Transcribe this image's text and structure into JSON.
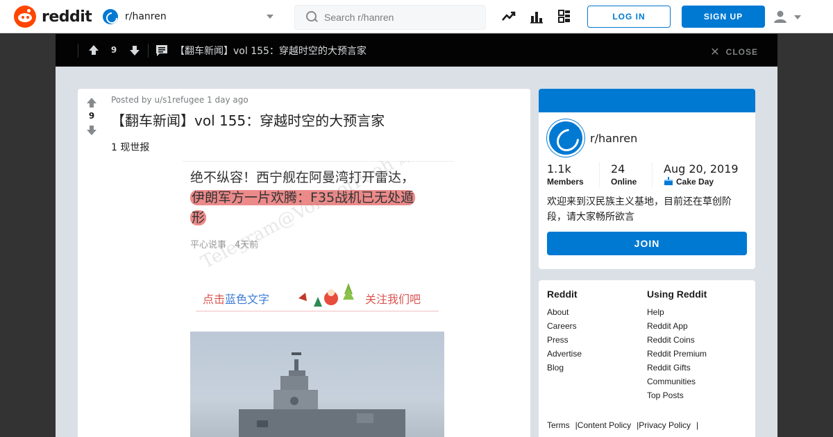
{
  "header": {
    "logo_text": "reddit",
    "community": "r/hanren",
    "search_placeholder": "Search r/hanren",
    "login_label": "LOG IN",
    "signup_label": "SIGN UP"
  },
  "overlay": {
    "score": "9",
    "title": "【翻车新闻】vol 155：穿越时空的大预言家",
    "close_label": "CLOSE"
  },
  "post": {
    "score": "9",
    "meta": "Posted by u/s1refugee 1 day ago",
    "title": "【翻车新闻】vol 155：穿越时空的大预言家",
    "flair": "1 现世报",
    "image": {
      "headline_part1": "绝不纵容！西宁舰在阿曼湾打开雷达，",
      "headline_part2": "伊朗军方一片欢腾：F35战机已无处遁",
      "headline_part3": "形",
      "source": "平心说事",
      "source_time": "4天前",
      "follow_part1": "点击",
      "follow_blue": "蓝色文字",
      "follow_part2": "关注我们吧",
      "watermark": "Telegram@VoiceofPooh 維尼之聲"
    }
  },
  "about": {
    "name": "r/hanren",
    "members_value": "1.1k",
    "members_label": "Members",
    "online_value": "24",
    "online_label": "Online",
    "created_value": "Aug 20, 2019",
    "created_label": "Cake Day",
    "description": "欢迎来到汉民族主义基地，目前还在草创阶段，请大家畅所欲言",
    "join_label": "JOIN"
  },
  "footer": {
    "col1_head": "Reddit",
    "col1_links": [
      "About",
      "Careers",
      "Press",
      "Advertise",
      "Blog"
    ],
    "col2_head": "Using Reddit",
    "col2_links": [
      "Help",
      "Reddit App",
      "Reddit Coins",
      "Reddit Premium",
      "Reddit Gifts",
      "Communities",
      "Top Posts"
    ],
    "bottom_links": [
      "Terms",
      "Content Policy",
      "Privacy Policy"
    ]
  },
  "colors": {
    "brand": "#ff4500",
    "accent": "#0079d3",
    "overlay_bg": "#030303",
    "page_bg": "#dae0e6"
  }
}
